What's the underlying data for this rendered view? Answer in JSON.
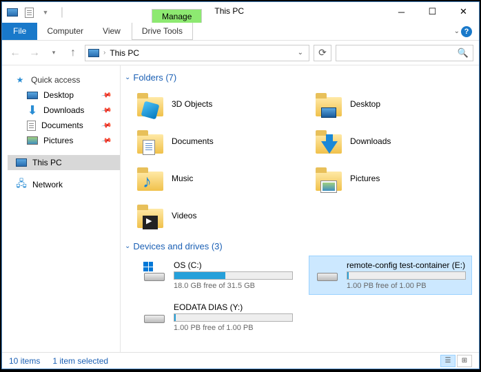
{
  "titlebar": {
    "title": "This PC",
    "context_tab_group": "Manage",
    "context_tab": "Drive Tools"
  },
  "ribbon": {
    "file": "File",
    "tabs": [
      "Computer",
      "View"
    ]
  },
  "nav": {
    "location": "This PC"
  },
  "sidebar": {
    "quick_access": "Quick access",
    "items": [
      {
        "label": "Desktop",
        "pinned": true
      },
      {
        "label": "Downloads",
        "pinned": true
      },
      {
        "label": "Documents",
        "pinned": true
      },
      {
        "label": "Pictures",
        "pinned": true
      }
    ],
    "this_pc": "This PC",
    "network": "Network"
  },
  "sections": {
    "folders_header": "Folders (7)",
    "folders": [
      {
        "label": "3D Objects"
      },
      {
        "label": "Desktop"
      },
      {
        "label": "Documents"
      },
      {
        "label": "Downloads"
      },
      {
        "label": "Music"
      },
      {
        "label": "Pictures"
      },
      {
        "label": "Videos"
      }
    ],
    "drives_header": "Devices and drives (3)",
    "drives": [
      {
        "name": "OS (C:)",
        "free": "18.0 GB free of 31.5 GB",
        "fill_pct": 43,
        "selected": false,
        "winlogo": true
      },
      {
        "name": "remote-config test-container (E:)",
        "free": "1.00 PB free of 1.00 PB",
        "fill_pct": 1,
        "selected": true,
        "winlogo": false
      },
      {
        "name": "EODATA DIAS (Y:)",
        "free": "1.00 PB free of 1.00 PB",
        "fill_pct": 1,
        "selected": false,
        "winlogo": false
      }
    ]
  },
  "statusbar": {
    "count": "10 items",
    "selected": "1 item selected"
  }
}
